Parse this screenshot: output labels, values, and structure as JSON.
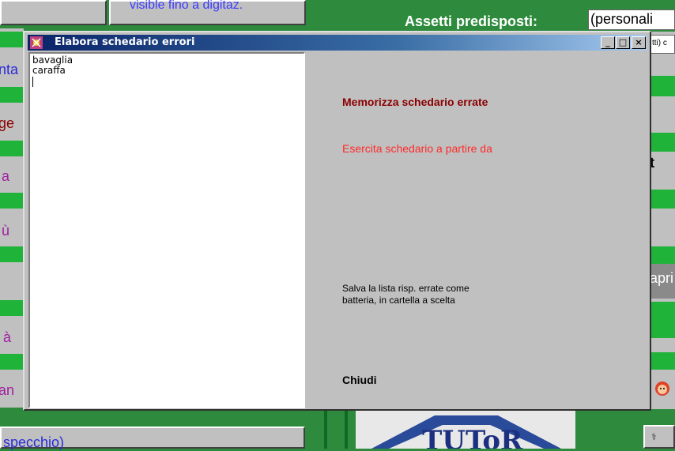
{
  "background": {
    "top_gray_text": "visible fino a digitaz.",
    "assetti_label": "Assetti predisposti:",
    "assetti_value": "(personali",
    "small_right_text": "tti) c",
    "left_fragments": [
      "nta",
      "ge",
      "a",
      "ù",
      "à",
      "an"
    ],
    "right_fragments": [
      "t",
      "apri"
    ],
    "bottom_left_text": "specchio)",
    "logo_text": "TUToR"
  },
  "dialog": {
    "title": "Elabora schedario errori",
    "controls": {
      "minimize": "_",
      "maximize": "□",
      "close": "×"
    },
    "list_items": [
      "bavaglia",
      "caraffa"
    ],
    "actions": {
      "memorizza": "Memorizza schedario errate",
      "esercita": "Esercita schedario a partire da",
      "salva_line1": "Salva la lista risp. errate come",
      "salva_line2": "batteria, in cartella a scelta",
      "chiudi": "Chiudi"
    },
    "colors": {
      "memorizza": "#8b0000",
      "esercita": "#ff2a2a"
    }
  }
}
